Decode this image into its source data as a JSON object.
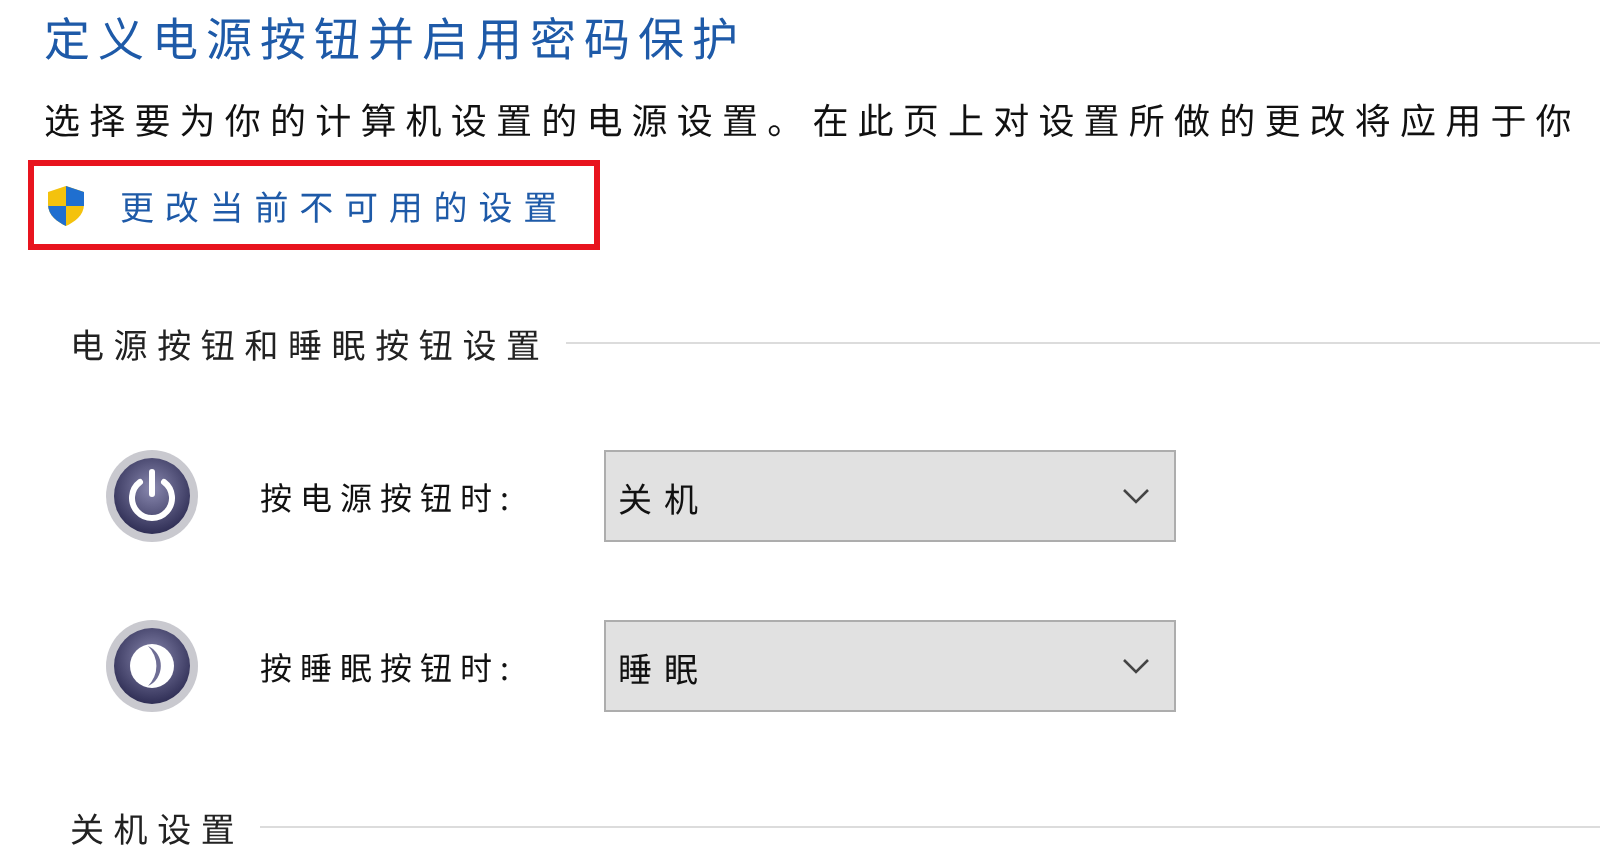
{
  "title": "定义电源按钮并启用密码保护",
  "description": "选择要为你的计算机设置的电源设置。在此页上对设置所做的更改将应用于你",
  "admin_link": {
    "label": "更改当前不可用的设置",
    "highlighted": true
  },
  "sections": [
    {
      "heading": "电源按钮和睡眠按钮设置",
      "rows": [
        {
          "kind": "power",
          "label": "按电源按钮时:",
          "value": "关机"
        },
        {
          "kind": "sleep",
          "label": "按睡眠按钮时:",
          "value": "睡眠"
        }
      ]
    },
    {
      "heading": "关机设置"
    }
  ]
}
